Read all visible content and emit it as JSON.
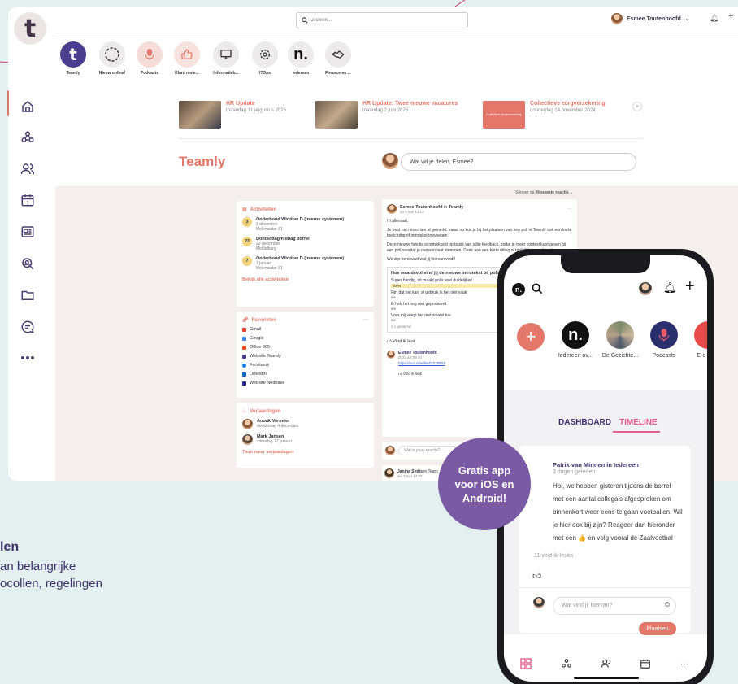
{
  "search": {
    "placeholder": "Zoeken..."
  },
  "user": {
    "name": "Esmee Toutenhoofd"
  },
  "channels": [
    {
      "label": "Teamly"
    },
    {
      "label": "Nieuw online!"
    },
    {
      "label": "Podcasts"
    },
    {
      "label": "Klant revie..."
    },
    {
      "label": "Informatieb..."
    },
    {
      "label": "ITOps"
    },
    {
      "label": "Iedereen"
    },
    {
      "label": "Finance en ..."
    }
  ],
  "news": [
    {
      "title": "HR Update",
      "date": "maandag 11 augustus 2025"
    },
    {
      "title": "HR Update: Twee nieuwe vacatures",
      "date": "maandag 2 juni 2025"
    },
    {
      "title": "Collectieve zorgverzekering",
      "date": "donderdag 14 november 2024",
      "thumb_text": "Collectieve zorgverzekering"
    }
  ],
  "page_title": "Teamly",
  "share_placeholder": "Wat wil je delen, Esmee?",
  "activities": {
    "title": "Activiteiten",
    "items": [
      {
        "day": "3",
        "title": "Onderhoud Window D (interne systemen)",
        "date": "3 december",
        "place": "Molenwater 81"
      },
      {
        "day": "23",
        "title": "Donderdagmiddag borrel",
        "date": "23 december",
        "place": "Middelburg"
      },
      {
        "day": "7",
        "title": "Onderhoud Window D (interne systemen)",
        "date": "7 januari",
        "place": "Molenwater 81"
      }
    ],
    "more": "Bekijk alle activiteiten"
  },
  "favorites": {
    "title": "Favorieten",
    "items": [
      "Gmail",
      "Google",
      "Office 365",
      "Website Teamly",
      "Facebook",
      "LinkedIn",
      "Website Nedbase"
    ]
  },
  "birthdays": {
    "title": "Verjaardagen",
    "items": [
      {
        "name": "Anouk Vermeer",
        "date": "donderdag 4 december"
      },
      {
        "name": "Mark Jansen",
        "date": "zaterdag 17 januari"
      }
    ],
    "more": "Toon meer verjaardagen"
  },
  "feed": {
    "sort_label": "Sorteer op:",
    "sort_value": "Nieuwste reactie",
    "author": "Esmee Toutenhoofd",
    "in_label": "in",
    "channel": "Teamly",
    "date": "do 5 juni 14:13",
    "greeting": "Hi allemaal,",
    "p1": "Je hebt het misschien al gemerkt: vanaf nu kun je bij het plaatsen van een poll in Teamly ook een korte toelichting of introtekst toevoegen.",
    "p2": "Deze nieuwe functie is ontwikkeld op basis van jullie feedback, zodat je meer context kunt geven bij een poll voordat je mensen laat stemmen. Denk aan een korte uitleg of toelichting op de opties.",
    "p3": "We zijn benieuwd wat jij hiervan vindt!",
    "poll_q": "Hoe waardevol vind jij de nieuwe introtekst bij polls?",
    "poll": [
      {
        "label": "Super handig, dit maakt polls veel duidelijker!",
        "pct": "100%"
      },
      {
        "label": "Fijn dat het kan, al gebruik ik het niet vaak",
        "pct": "0%"
      },
      {
        "label": "Ik heb het nog niet geprobeerd",
        "pct": "0%"
      },
      {
        "label": "Voor mij voegt het niet zoveel toe",
        "pct": "0%"
      }
    ],
    "votes": "1 x gestemd",
    "like": "Vind ik leuk",
    "reply_author": "Esmee Toutenhoofd",
    "reply_date": "di 22 juli 09:10",
    "reply_link": "https://nos.nl/artikel/2579931",
    "reply_like": "Vind ik leuk",
    "reply_placeholder": "Wat is jouw reactie?",
    "next_author": "Janine Smits",
    "next_in": "in Team",
    "next_date": "wo 7 mei 14:03"
  },
  "phone": {
    "stories": [
      {
        "label": "Iedereen ov..."
      },
      {
        "label": "De Gezichte..."
      },
      {
        "label": "Podcasts"
      },
      {
        "label": "E-c"
      }
    ],
    "tab_dashboard": "DASHBOARD",
    "tab_timeline": "TIMELINE",
    "post_author": "Patrik van Minnen in Iedereen",
    "post_time": "3 dagen geleden",
    "post_text": "Hoi, we hebben gisteren tijdens de borrel met een aantal collega's afgesproken om binnenkort weer eens te gaan voetballen. Wil je hier ook bij zijn? Reageer dan hieronder met een 👍 en volg vooral de Zaalvoetbal kring. Binnenkort zullen we binnenkort een aantal data voorstellen ⚽👍",
    "likes": "11 vind-ik-leuks",
    "comment_placeholder": "Wat vind jij hiervan?",
    "post_button": "Plaatsen"
  },
  "badge": {
    "line1": "Gratis app",
    "line2": "voor iOS en",
    "line3": "Android!"
  },
  "footer": {
    "title": "len",
    "line1": "an belangrijke",
    "line2": "ocollen, regelingen"
  },
  "colors": {
    "accent": "#e3786a",
    "purple": "#7a5aa3",
    "navy": "#3d2f6a"
  }
}
